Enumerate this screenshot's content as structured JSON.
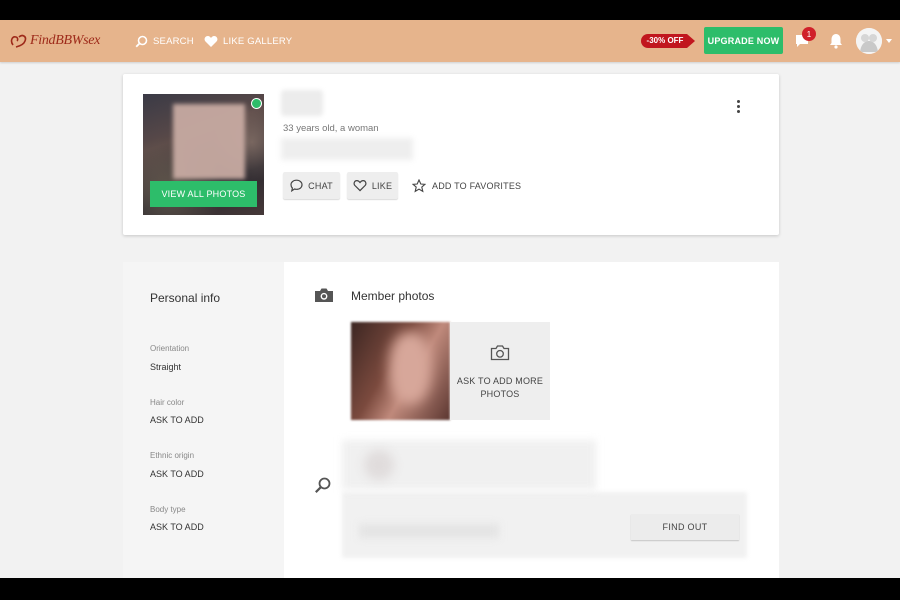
{
  "header": {
    "logo_text": "FindBBWsex",
    "nav": [
      {
        "label": "SEARCH",
        "icon": "search-icon"
      },
      {
        "label": "LIKE GALLERY",
        "icon": "heart-icon"
      }
    ],
    "discount_label": "-30% OFF",
    "upgrade_label": "UPGRADE NOW",
    "chat_badge_count": "1",
    "colors": {
      "header_bg": "#e6b48c",
      "upgrade_green": "#2dbd6a",
      "discount_red": "#c1161e",
      "badge_red": "#d0202a"
    }
  },
  "profile": {
    "age_gender": "33 years old, a woman",
    "online": true,
    "view_photos_label": "VIEW ALL PHOTOS",
    "actions": {
      "chat_label": "CHAT",
      "like_label": "LIKE",
      "favorites_label": "ADD TO FAVORITES"
    }
  },
  "personal_info": {
    "title": "Personal info",
    "fields": [
      {
        "label": "Orientation",
        "value": "Straight"
      },
      {
        "label": "Hair color",
        "value": "ASK TO ADD"
      },
      {
        "label": "Ethnic origin",
        "value": "ASK TO ADD"
      },
      {
        "label": "Body type",
        "value": "ASK TO ADD"
      }
    ]
  },
  "member_photos": {
    "title": "Member photos",
    "ask_more_label": "ASK TO ADD MORE PHOTOS"
  },
  "search_section": {
    "find_out_label": "FIND OUT"
  }
}
